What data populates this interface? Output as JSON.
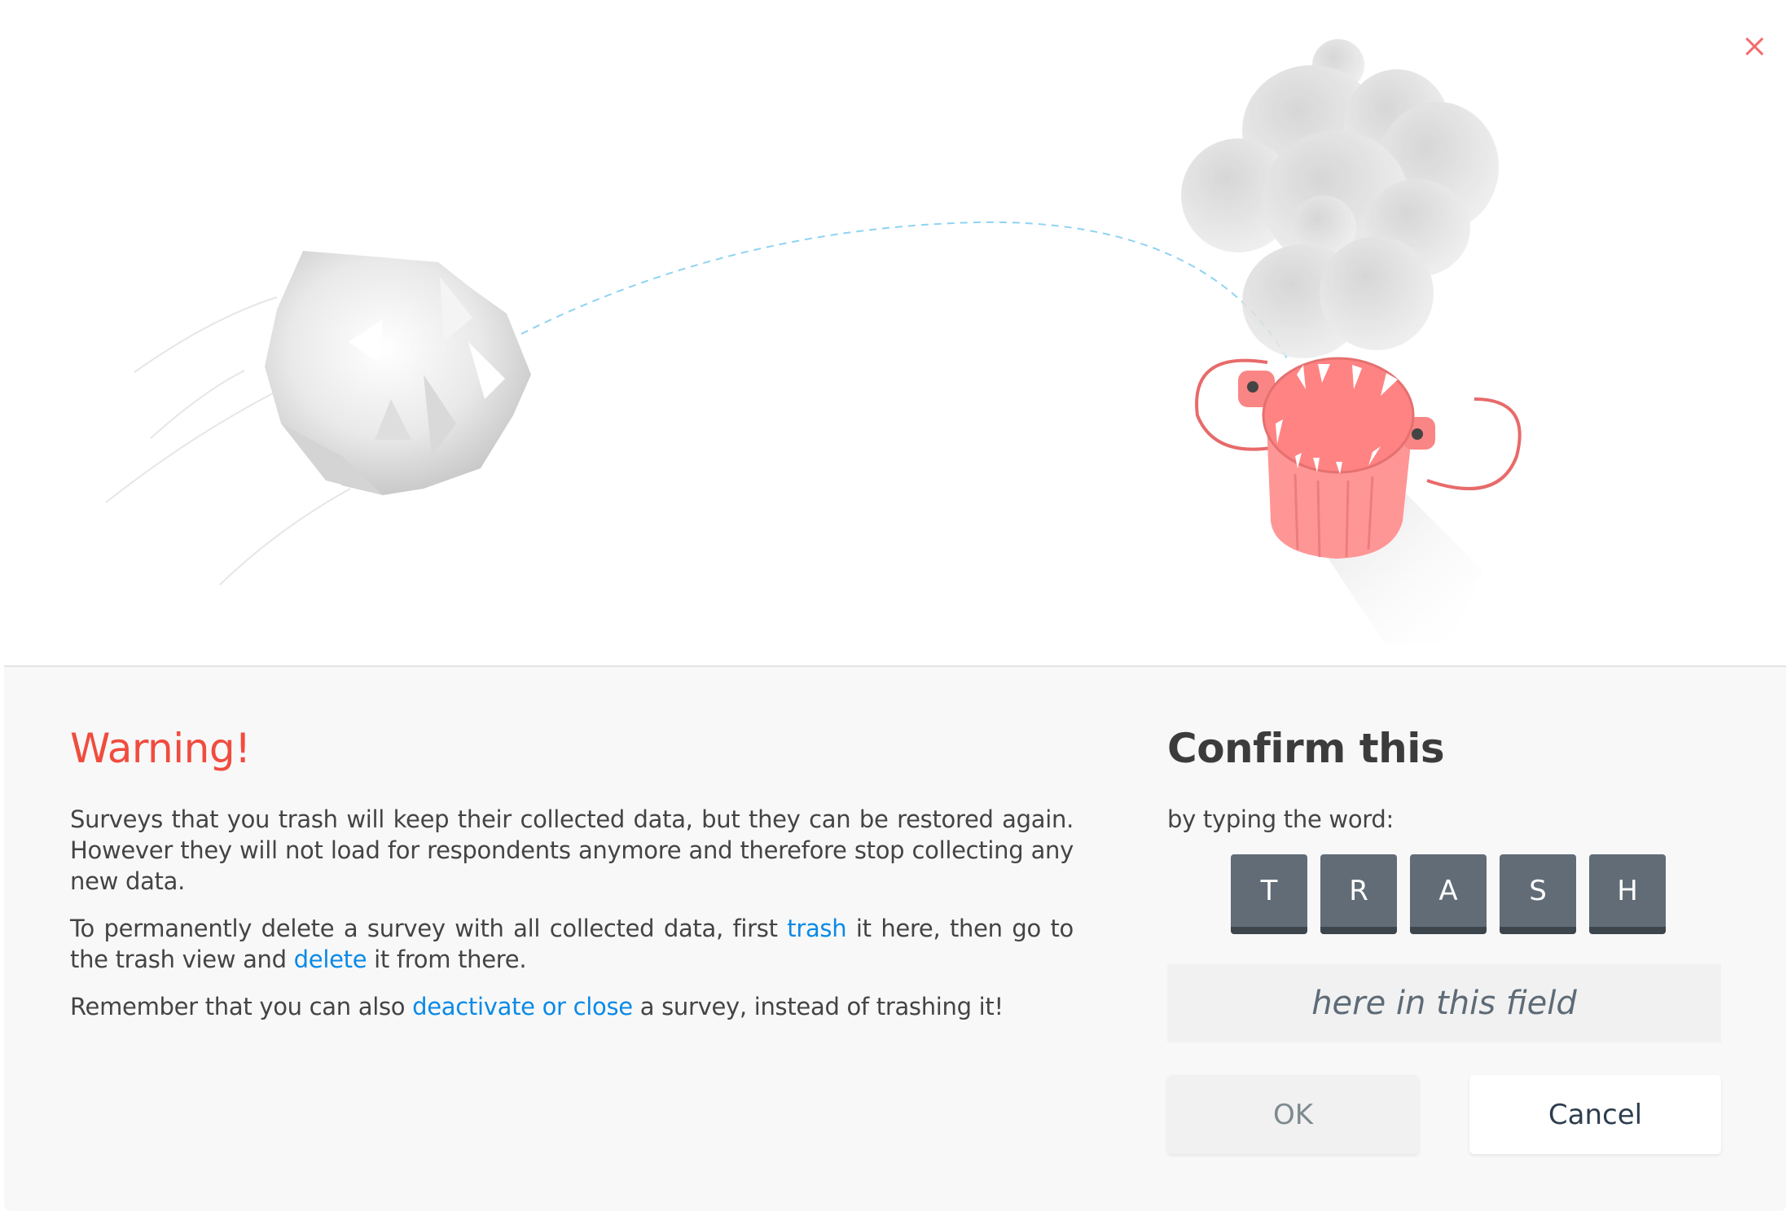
{
  "dialog": {
    "close_icon": "close-icon",
    "illustration": {
      "paper_ball": "crumpled-paper-icon",
      "trash_monster": "trash-can-monster-icon",
      "smoke": "smoke-cloud-icon"
    },
    "warning": {
      "title": "Warning!",
      "p1": "Surveys that you trash will keep their collected data, but they can be restored again. However they will not load for respondents anymore and therefore stop collecting any new data.",
      "p2_before": "To permanently delete a survey with all collected data, first ",
      "p2_link1": "trash",
      "p2_mid": " it here, then go to the trash view and ",
      "p2_link2": "delete",
      "p2_after": " it from there.",
      "p3_before": "Remember that you can also ",
      "p3_link": "deactivate or close",
      "p3_after": " a survey, instead of trashing it!"
    },
    "confirm": {
      "title": "Confirm this",
      "subtitle": "by typing the word:",
      "keys": [
        "T",
        "R",
        "A",
        "S",
        "H"
      ],
      "input_value": "",
      "input_placeholder": "here in this field",
      "ok_label": "OK",
      "cancel_label": "Cancel"
    },
    "colors": {
      "warning": "#f04c3e",
      "link": "#0a8ae6",
      "key": "#626c77",
      "close": "#f26b6b"
    }
  }
}
